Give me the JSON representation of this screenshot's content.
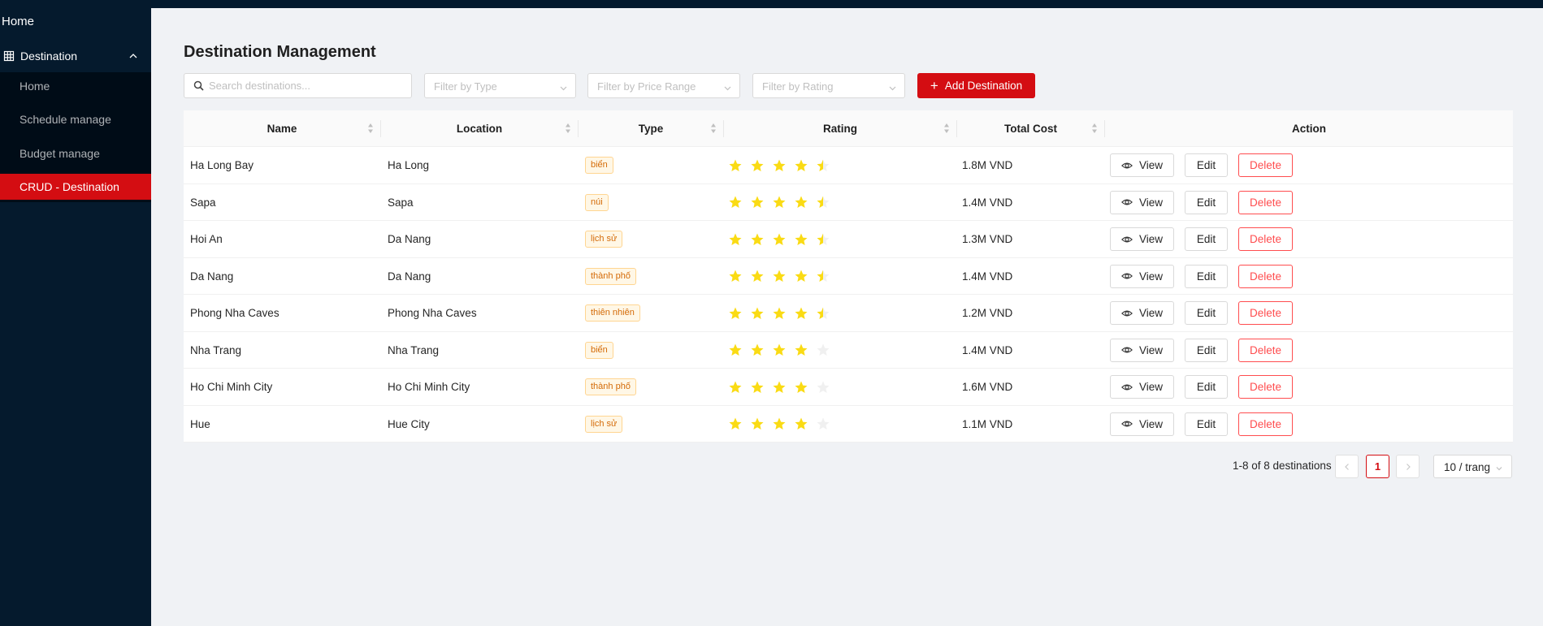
{
  "sidebar": {
    "home_label": "Home",
    "group_label": "Destination",
    "items": [
      {
        "label": "Home",
        "active": false
      },
      {
        "label": "Schedule manage",
        "active": false
      },
      {
        "label": "Budget manage",
        "active": false
      },
      {
        "label": "CRUD - Destination",
        "active": true
      }
    ]
  },
  "page": {
    "title": "Destination Management"
  },
  "toolbar": {
    "search_placeholder": "Search destinations...",
    "filter_type_placeholder": "Filter by Type",
    "filter_price_placeholder": "Filter by Price Range",
    "filter_rating_placeholder": "Filter by Rating",
    "add_label": "Add Destination"
  },
  "table": {
    "columns": [
      "Name",
      "Location",
      "Type",
      "Rating",
      "Total Cost",
      "Action"
    ],
    "rows": [
      {
        "name": "Ha Long Bay",
        "location": "Ha Long",
        "type": "biển",
        "rating": 4.5,
        "cost": "1.8M VND"
      },
      {
        "name": "Sapa",
        "location": "Sapa",
        "type": "núi",
        "rating": 4.5,
        "cost": "1.4M VND"
      },
      {
        "name": "Hoi An",
        "location": "Da Nang",
        "type": "lịch sử",
        "rating": 4.5,
        "cost": "1.3M VND"
      },
      {
        "name": "Da Nang",
        "location": "Da Nang",
        "type": "thành phố",
        "rating": 4.5,
        "cost": "1.4M VND"
      },
      {
        "name": "Phong Nha Caves",
        "location": "Phong Nha Caves",
        "type": "thiên nhiên",
        "rating": 4.5,
        "cost": "1.2M VND"
      },
      {
        "name": "Nha Trang",
        "location": "Nha Trang",
        "type": "biển",
        "rating": 4,
        "cost": "1.4M VND"
      },
      {
        "name": "Ho Chi Minh City",
        "location": "Ho Chi Minh City",
        "type": "thành phố",
        "rating": 4,
        "cost": "1.6M VND"
      },
      {
        "name": "Hue",
        "location": "Hue City",
        "type": "lịch sử",
        "rating": 4,
        "cost": "1.1M VND"
      }
    ],
    "actions": {
      "view": "View",
      "edit": "Edit",
      "delete": "Delete"
    }
  },
  "pagination": {
    "total_text": "1-8 of 8 destinations",
    "current_page": "1",
    "page_size": "10 / trang"
  },
  "colors": {
    "primary": "#d40d12",
    "sidebar_bg": "#051a2d",
    "star": "#fadb14",
    "star_empty": "#f0f0f0",
    "tag_text": "#d46b08"
  }
}
